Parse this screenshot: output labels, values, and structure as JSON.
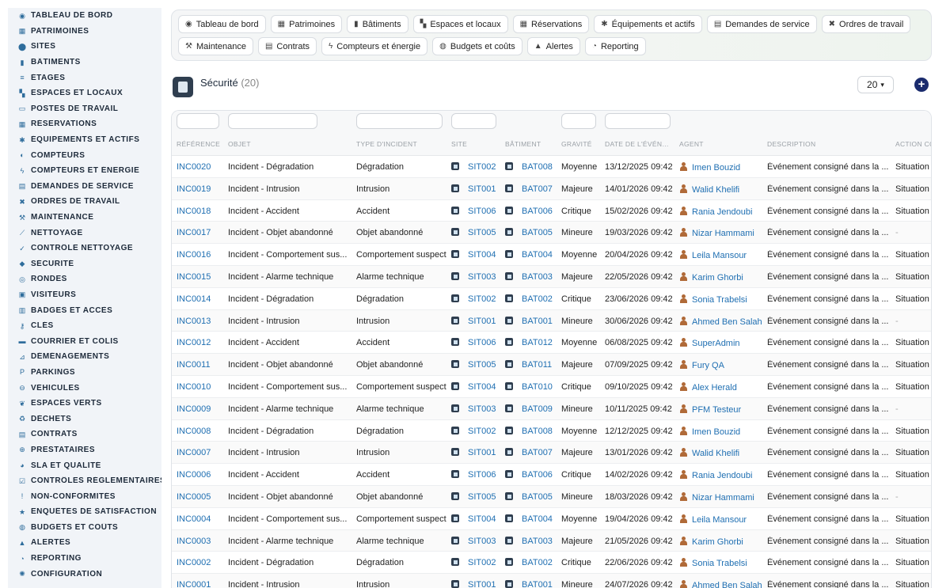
{
  "sidebar": {
    "items": [
      {
        "label": "TABLEAU DE BORD",
        "icon": "dashboard-icon",
        "glyph": "◉"
      },
      {
        "label": "PATRIMOINES",
        "icon": "building-group-icon",
        "glyph": "▦"
      },
      {
        "label": "SITES",
        "icon": "location-pin-icon",
        "glyph": "⬤"
      },
      {
        "label": "BÂTIMENTS",
        "icon": "building-icon",
        "glyph": "▮"
      },
      {
        "label": "ÉTAGES",
        "icon": "layers-icon",
        "glyph": "≡"
      },
      {
        "label": "ESPACES ET LOCAUX",
        "icon": "door-icon",
        "glyph": "▚"
      },
      {
        "label": "POSTES DE TRAVAIL",
        "icon": "monitor-icon",
        "glyph": "▭"
      },
      {
        "label": "RÉSERVATIONS",
        "icon": "calendar-icon",
        "glyph": "▦"
      },
      {
        "label": "ÉQUIPEMENTS ET ACTIFS",
        "icon": "gears-icon",
        "glyph": "✱"
      },
      {
        "label": "COMPTEURS",
        "icon": "gauge-icon",
        "glyph": "◐"
      },
      {
        "label": "COMPTEURS ET ÉNERGIE",
        "icon": "bolt-icon",
        "glyph": "ϟ"
      },
      {
        "label": "DEMANDES DE SERVICE",
        "icon": "clipboard-icon",
        "glyph": "▤"
      },
      {
        "label": "ORDRES DE TRAVAIL",
        "icon": "tools-icon",
        "glyph": "✖"
      },
      {
        "label": "MAINTENANCE",
        "icon": "wrench-icon",
        "glyph": "⚒"
      },
      {
        "label": "NETTOYAGE",
        "icon": "broom-icon",
        "glyph": "⟋"
      },
      {
        "label": "CONTRÔLE NETTOYAGE",
        "icon": "check-broom-icon",
        "glyph": "✓"
      },
      {
        "label": "SÉCURITÉ",
        "icon": "shield-icon",
        "glyph": "◆"
      },
      {
        "label": "RONDES",
        "icon": "route-icon",
        "glyph": "◎"
      },
      {
        "label": "VISITEURS",
        "icon": "id-card-icon",
        "glyph": "▣"
      },
      {
        "label": "BADGES ET ACCÈS",
        "icon": "badge-icon",
        "glyph": "▥"
      },
      {
        "label": "CLÉS",
        "icon": "key-icon",
        "glyph": "⚷"
      },
      {
        "label": "COURRIER ET COLIS",
        "icon": "truck-icon",
        "glyph": "▬"
      },
      {
        "label": "DÉMÉNAGEMENTS",
        "icon": "dolly-icon",
        "glyph": "⊿"
      },
      {
        "label": "PARKINGS",
        "icon": "parking-icon",
        "glyph": "P"
      },
      {
        "label": "VÉHICULES",
        "icon": "car-icon",
        "glyph": "⊖"
      },
      {
        "label": "ESPACES VERTS",
        "icon": "leaf-icon",
        "glyph": "❦"
      },
      {
        "label": "DÉCHETS",
        "icon": "recycle-icon",
        "glyph": "♻"
      },
      {
        "label": "CONTRATS",
        "icon": "contract-icon",
        "glyph": "▤"
      },
      {
        "label": "PRESTATAIRES",
        "icon": "handshake-icon",
        "glyph": "⊕"
      },
      {
        "label": "SLA ET QUALITÉ",
        "icon": "chart-icon",
        "glyph": "◕"
      },
      {
        "label": "CONTRÔLES RÉGLEMENTAIRES",
        "icon": "checklist-icon",
        "glyph": "☑"
      },
      {
        "label": "NON-CONFORMITÉS",
        "icon": "alert-circle-icon",
        "glyph": "!"
      },
      {
        "label": "ENQUÊTES DE SATISFACTION",
        "icon": "star-icon",
        "glyph": "★"
      },
      {
        "label": "BUDGETS ET COÛTS",
        "icon": "coins-icon",
        "glyph": "◍"
      },
      {
        "label": "ALERTES",
        "icon": "bell-icon",
        "glyph": "▲"
      },
      {
        "label": "REPORTING",
        "icon": "pie-chart-icon",
        "glyph": "◔"
      },
      {
        "label": "CONFIGURATION",
        "icon": "gear-icon",
        "glyph": "✺"
      }
    ]
  },
  "tabs": {
    "row1": [
      {
        "label": "Tableau de bord",
        "icon": "dashboard-icon",
        "glyph": "◉"
      },
      {
        "label": "Patrimoines",
        "icon": "building-group-icon",
        "glyph": "▦"
      },
      {
        "label": "Bâtiments",
        "icon": "building-icon",
        "glyph": "▮"
      },
      {
        "label": "Espaces et locaux",
        "icon": "door-icon",
        "glyph": "▚"
      },
      {
        "label": "Réservations",
        "icon": "calendar-icon",
        "glyph": "▦"
      },
      {
        "label": "Équipements et actifs",
        "icon": "gears-icon",
        "glyph": "✱"
      },
      {
        "label": "Demandes de service",
        "icon": "clipboard-icon",
        "glyph": "▤"
      },
      {
        "label": "Ordres de travail",
        "icon": "tools-icon",
        "glyph": "✖"
      }
    ],
    "row2": [
      {
        "label": "Maintenance",
        "icon": "wrench-icon",
        "glyph": "⚒"
      },
      {
        "label": "Contrats",
        "icon": "contract-icon",
        "glyph": "▤"
      },
      {
        "label": "Compteurs et énergie",
        "icon": "bolt-icon",
        "glyph": "ϟ"
      },
      {
        "label": "Budgets et coûts",
        "icon": "coins-icon",
        "glyph": "◍"
      },
      {
        "label": "Alertes",
        "icon": "bell-icon",
        "glyph": "▲"
      },
      {
        "label": "Reporting",
        "icon": "pie-chart-icon",
        "glyph": "◔"
      }
    ]
  },
  "page": {
    "title": "Sécurité",
    "count": "(20)",
    "page_size": "20",
    "add_label": "+"
  },
  "table": {
    "headers": [
      "RÉFÉRENCE",
      "OBJET",
      "TYPE D'INCIDENT",
      "SITE",
      "BÂTIMENT",
      "GRAVITÉ",
      "DATE DE L'ÉVÉN…",
      "AGENT",
      "DESCRIPTION",
      "ACTION CO"
    ],
    "rows": [
      {
        "ref": "INC0020",
        "objet": "Incident - Dégradation",
        "type": "Dégradation",
        "site": "SIT002",
        "bat": "BAT008",
        "gravite": "Moyenne",
        "date": "13/12/2025 09:42",
        "agent": "Imen Bouzid",
        "desc": "Événement consigné dans la ...",
        "action": "Situation t"
      },
      {
        "ref": "INC0019",
        "objet": "Incident - Intrusion",
        "type": "Intrusion",
        "site": "SIT001",
        "bat": "BAT007",
        "gravite": "Majeure",
        "date": "14/01/2026 09:42",
        "agent": "Walid Khelifi",
        "desc": "Événement consigné dans la ...",
        "action": "Situation t"
      },
      {
        "ref": "INC0018",
        "objet": "Incident - Accident",
        "type": "Accident",
        "site": "SIT006",
        "bat": "BAT006",
        "gravite": "Critique",
        "date": "15/02/2026 09:42",
        "agent": "Rania Jendoubi",
        "desc": "Événement consigné dans la ...",
        "action": "Situation t"
      },
      {
        "ref": "INC0017",
        "objet": "Incident - Objet abandonné",
        "type": "Objet abandonné",
        "site": "SIT005",
        "bat": "BAT005",
        "gravite": "Mineure",
        "date": "19/03/2026 09:42",
        "agent": "Nizar Hammami",
        "desc": "Événement consigné dans la ...",
        "action": "-"
      },
      {
        "ref": "INC0016",
        "objet": "Incident - Comportement sus...",
        "type": "Comportement suspect",
        "site": "SIT004",
        "bat": "BAT004",
        "gravite": "Moyenne",
        "date": "20/04/2026 09:42",
        "agent": "Leila Mansour",
        "desc": "Événement consigné dans la ...",
        "action": "Situation t"
      },
      {
        "ref": "INC0015",
        "objet": "Incident - Alarme technique",
        "type": "Alarme technique",
        "site": "SIT003",
        "bat": "BAT003",
        "gravite": "Majeure",
        "date": "22/05/2026 09:42",
        "agent": "Karim Ghorbi",
        "desc": "Événement consigné dans la ...",
        "action": "Situation t"
      },
      {
        "ref": "INC0014",
        "objet": "Incident - Dégradation",
        "type": "Dégradation",
        "site": "SIT002",
        "bat": "BAT002",
        "gravite": "Critique",
        "date": "23/06/2026 09:42",
        "agent": "Sonia Trabelsi",
        "desc": "Événement consigné dans la ...",
        "action": "Situation t"
      },
      {
        "ref": "INC0013",
        "objet": "Incident - Intrusion",
        "type": "Intrusion",
        "site": "SIT001",
        "bat": "BAT001",
        "gravite": "Mineure",
        "date": "30/06/2026 09:42",
        "agent": "Ahmed Ben Salah",
        "desc": "Événement consigné dans la ...",
        "action": "-"
      },
      {
        "ref": "INC0012",
        "objet": "Incident - Accident",
        "type": "Accident",
        "site": "SIT006",
        "bat": "BAT012",
        "gravite": "Moyenne",
        "date": "06/08/2025 09:42",
        "agent": "SuperAdmin",
        "desc": "Événement consigné dans la ...",
        "action": "Situation t"
      },
      {
        "ref": "INC0011",
        "objet": "Incident - Objet abandonné",
        "type": "Objet abandonné",
        "site": "SIT005",
        "bat": "BAT011",
        "gravite": "Majeure",
        "date": "07/09/2025 09:42",
        "agent": "Fury QA",
        "desc": "Événement consigné dans la ...",
        "action": "Situation t"
      },
      {
        "ref": "INC0010",
        "objet": "Incident - Comportement sus...",
        "type": "Comportement suspect",
        "site": "SIT004",
        "bat": "BAT010",
        "gravite": "Critique",
        "date": "09/10/2025 09:42",
        "agent": "Alex Herald",
        "desc": "Événement consigné dans la ...",
        "action": "Situation t"
      },
      {
        "ref": "INC0009",
        "objet": "Incident - Alarme technique",
        "type": "Alarme technique",
        "site": "SIT003",
        "bat": "BAT009",
        "gravite": "Mineure",
        "date": "10/11/2025 09:42",
        "agent": "PFM Testeur",
        "desc": "Événement consigné dans la ...",
        "action": "-"
      },
      {
        "ref": "INC0008",
        "objet": "Incident - Dégradation",
        "type": "Dégradation",
        "site": "SIT002",
        "bat": "BAT008",
        "gravite": "Moyenne",
        "date": "12/12/2025 09:42",
        "agent": "Imen Bouzid",
        "desc": "Événement consigné dans la ...",
        "action": "Situation t"
      },
      {
        "ref": "INC0007",
        "objet": "Incident - Intrusion",
        "type": "Intrusion",
        "site": "SIT001",
        "bat": "BAT007",
        "gravite": "Majeure",
        "date": "13/01/2026 09:42",
        "agent": "Walid Khelifi",
        "desc": "Événement consigné dans la ...",
        "action": "Situation t"
      },
      {
        "ref": "INC0006",
        "objet": "Incident - Accident",
        "type": "Accident",
        "site": "SIT006",
        "bat": "BAT006",
        "gravite": "Critique",
        "date": "14/02/2026 09:42",
        "agent": "Rania Jendoubi",
        "desc": "Événement consigné dans la ...",
        "action": "Situation t"
      },
      {
        "ref": "INC0005",
        "objet": "Incident - Objet abandonné",
        "type": "Objet abandonné",
        "site": "SIT005",
        "bat": "BAT005",
        "gravite": "Mineure",
        "date": "18/03/2026 09:42",
        "agent": "Nizar Hammami",
        "desc": "Événement consigné dans la ...",
        "action": "-"
      },
      {
        "ref": "INC0004",
        "objet": "Incident - Comportement sus...",
        "type": "Comportement suspect",
        "site": "SIT004",
        "bat": "BAT004",
        "gravite": "Moyenne",
        "date": "19/04/2026 09:42",
        "agent": "Leila Mansour",
        "desc": "Événement consigné dans la ...",
        "action": "Situation t"
      },
      {
        "ref": "INC0003",
        "objet": "Incident - Alarme technique",
        "type": "Alarme technique",
        "site": "SIT003",
        "bat": "BAT003",
        "gravite": "Majeure",
        "date": "21/05/2026 09:42",
        "agent": "Karim Ghorbi",
        "desc": "Événement consigné dans la ...",
        "action": "Situation t"
      },
      {
        "ref": "INC0002",
        "objet": "Incident - Dégradation",
        "type": "Dégradation",
        "site": "SIT002",
        "bat": "BAT002",
        "gravite": "Critique",
        "date": "22/06/2026 09:42",
        "agent": "Sonia Trabelsi",
        "desc": "Événement consigné dans la ...",
        "action": "Situation t"
      },
      {
        "ref": "INC0001",
        "objet": "Incident - Intrusion",
        "type": "Intrusion",
        "site": "SIT001",
        "bat": "BAT001",
        "gravite": "Mineure",
        "date": "24/07/2026 09:42",
        "agent": "Ahmed Ben Salah",
        "desc": "Événement consigné dans la ...",
        "action": "Situation t"
      }
    ]
  },
  "colors": {
    "link": "#1f6fb2",
    "sidebar_bg": "#f1f4f8",
    "accent_dark": "#1a2b6d",
    "agent_icon": "#b06a38"
  }
}
